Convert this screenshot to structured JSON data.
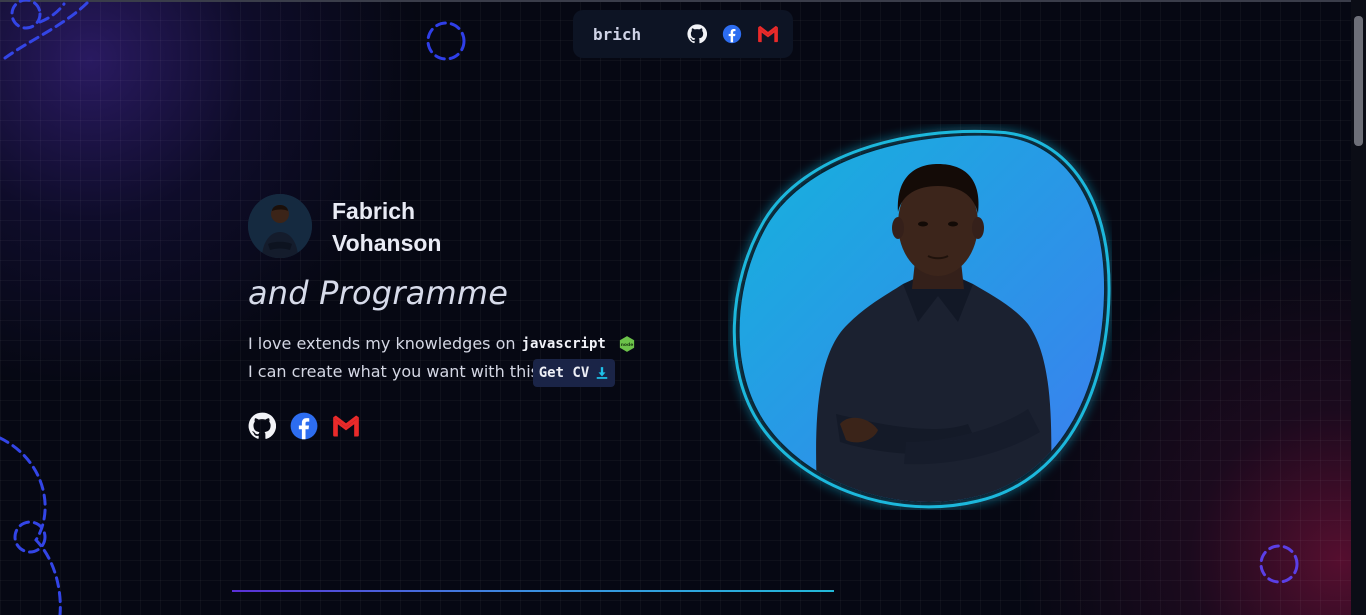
{
  "navbar": {
    "brand": "brich",
    "icons": [
      "github-icon",
      "facebook-icon",
      "gmail-icon"
    ]
  },
  "hero": {
    "name_first": "Fabrich",
    "name_last": "Vohanson",
    "tagline": "and Programme",
    "intro_text": "I love extends my knowledges on",
    "intro_code": "javascript",
    "intro_badge": "node-icon",
    "second_line": "I can create what you want with this.",
    "cv_button": "Get CV",
    "cv_icon": "download-icon",
    "socials": [
      "github-icon",
      "facebook-icon",
      "gmail-icon"
    ]
  },
  "colors": {
    "background": "#060813",
    "accent_blue": "#2f3fe8",
    "portrait_gradient_start": "#14b4dc",
    "portrait_gradient_end": "#3d7cf0",
    "facebook": "#1877f2",
    "gmail_red": "#ea4335",
    "node_green": "#6cc24a"
  }
}
